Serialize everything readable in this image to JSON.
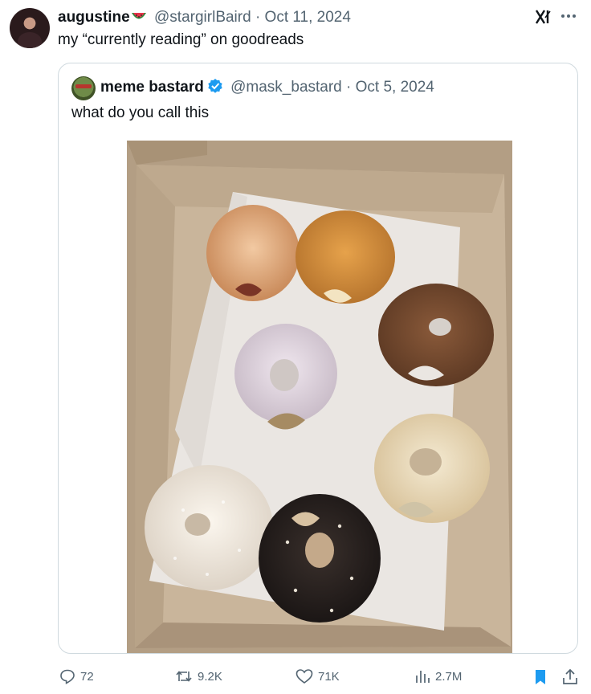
{
  "tweet": {
    "author_name": "augustine",
    "author_handle": "@stargirlBaird",
    "date": "· Oct 11, 2024",
    "text": "my “currently reading” on goodreads"
  },
  "quote": {
    "author_name": "meme bastard",
    "author_handle": "@mask_bastard",
    "date": "· Oct 5, 2024",
    "text": "what do you call this"
  },
  "actions": {
    "replies": "72",
    "reposts": "9.2K",
    "likes": "71K",
    "views": "2.7M"
  },
  "icons": [
    "watermelon-icon",
    "verified-badge-icon",
    "grok-icon",
    "more-icon",
    "reply-icon",
    "repost-icon",
    "like-icon",
    "views-icon",
    "bookmark-icon",
    "share-icon"
  ],
  "colors": {
    "accent": "#1d9bf0",
    "muted": "#536471",
    "border": "#cfd9de"
  }
}
